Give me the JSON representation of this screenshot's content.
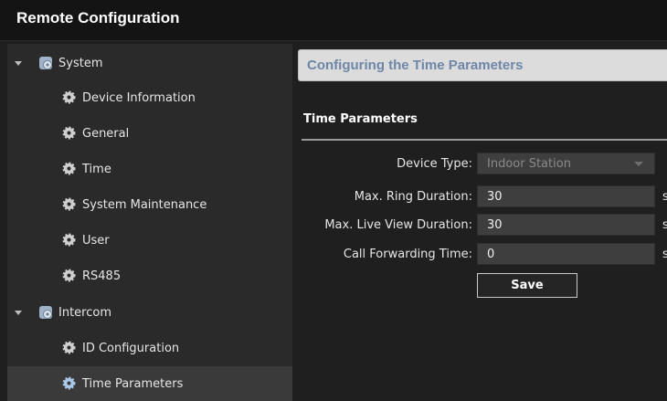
{
  "window": {
    "title": "Remote Configuration"
  },
  "sidebar": {
    "groups": [
      {
        "label": "System",
        "icon": "system-gear-icon",
        "items": [
          "Device Information",
          "General",
          "Time",
          "System Maintenance",
          "User",
          "RS485"
        ]
      },
      {
        "label": "Intercom",
        "icon": "intercom-gear-icon",
        "items": [
          "ID Configuration",
          "Time Parameters"
        ]
      }
    ],
    "selected": "Time Parameters"
  },
  "main": {
    "header": "Configuring the Time Parameters",
    "section": "Time Parameters",
    "fields": {
      "device_type": {
        "label": "Device Type:",
        "value": "Indoor Station"
      },
      "max_ring": {
        "label": "Max. Ring Duration:",
        "value": "30",
        "unit": "s"
      },
      "max_live": {
        "label": "Max. Live View Duration:",
        "value": "30",
        "unit": "s"
      },
      "call_fwd": {
        "label": "Call Forwarding Time:",
        "value": "0",
        "unit": "s"
      }
    },
    "save_label": "Save"
  },
  "colors": {
    "header_text": "#6e86a8",
    "background": "#1f1f1f",
    "sidebar": "#2a2a2a",
    "titlebar": "#141414"
  }
}
